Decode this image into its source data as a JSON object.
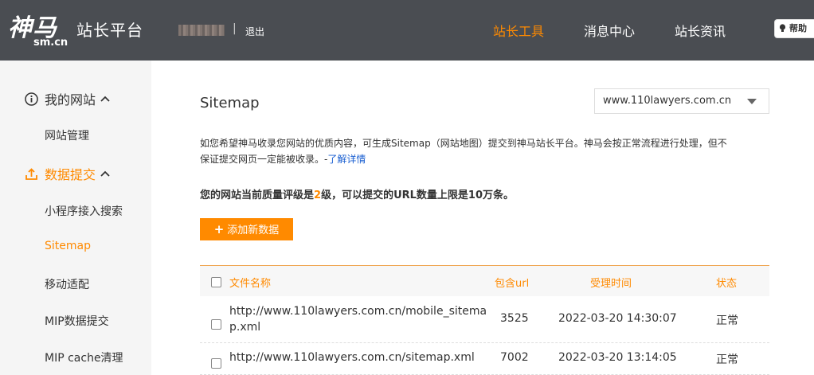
{
  "header": {
    "logo_main": "神马",
    "logo_sub": "sm.cn",
    "platform_name": "站长平台",
    "divider": "|",
    "logout": "退出",
    "nav": [
      {
        "label": "站长工具",
        "active": true
      },
      {
        "label": "消息中心",
        "active": false
      },
      {
        "label": "站长资讯",
        "active": false
      }
    ],
    "help": "帮助"
  },
  "sidebar": {
    "sections": [
      {
        "label": "我的网站",
        "icon": "info-circle-icon",
        "color": "#333333"
      },
      {
        "label": "数据提交",
        "icon": "upload-icon",
        "color": "#ff8a00"
      }
    ],
    "items": [
      {
        "label": "网站管理",
        "active": false
      },
      {
        "label": "小程序接入搜索",
        "active": false
      },
      {
        "label": "Sitemap",
        "active": true
      },
      {
        "label": "移动适配",
        "active": false
      },
      {
        "label": "MIP数据提交",
        "active": false
      },
      {
        "label": "MIP cache清理",
        "active": false
      }
    ]
  },
  "main": {
    "title": "Sitemap",
    "domain_select": "www.110lawyers.com.cn",
    "description_line1": "如您希望神马收录您网站的优质内容，可生成Sitemap（网站地图）提交到神马站长平台。神马会按正常流程进行处理，但不",
    "description_line2": "保证提交网页一定能被收录。-",
    "description_link": "了解详情",
    "quota_prefix": "您的网站当前质量评级是",
    "quota_level": "2",
    "quota_suffix": "级，可以提交的URL数量上限是10万条。",
    "add_button": "添加新数据"
  },
  "table": {
    "headers": {
      "name": "文件名称",
      "url_count": "包含url",
      "time": "受理时间",
      "status": "状态"
    },
    "rows": [
      {
        "name_line1": "http://www.110lawyers.com.cn/mobile_sitema",
        "name_line2": "p.xml",
        "url_count": "3525",
        "time": "2022-03-20 14:30:07",
        "status": "正常"
      },
      {
        "name_line1": "http://www.110lawyers.com.cn/sitemap.xml",
        "name_line2": "",
        "url_count": "7002",
        "time": "2022-03-20 13:14:05",
        "status": "正常"
      }
    ]
  },
  "colors": {
    "accent": "#ff8a00",
    "header_bg": "#4a4d52",
    "link": "#1a5fd1"
  }
}
